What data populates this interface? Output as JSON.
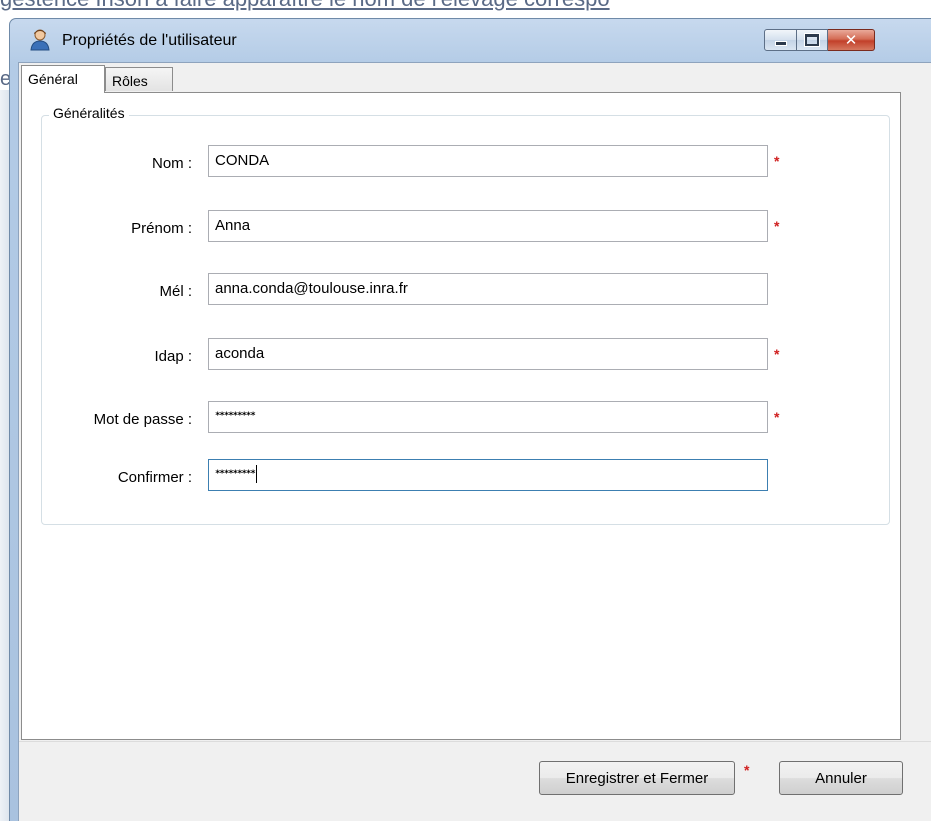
{
  "background": {
    "top_text": "gestence Inson à faire apparaître le nom de l'élevage correspo",
    "left_fragment": "e,"
  },
  "window": {
    "title": "Propriétés de l'utilisateur",
    "title_icon": "user-icon",
    "controls": {
      "minimize": "minimize-icon",
      "maximize": "maximize-icon",
      "close": "close-icon"
    }
  },
  "tabs": [
    {
      "label": "Général",
      "active": true
    },
    {
      "label": "Rôles",
      "active": false
    }
  ],
  "group": {
    "title": "Généralités",
    "fields": [
      {
        "label": "Nom :",
        "value": "CONDA",
        "required": true
      },
      {
        "label": "Prénom :",
        "value": "Anna",
        "required": true
      },
      {
        "label": "Mél :",
        "value": "anna.conda@toulouse.inra.fr",
        "required": false
      },
      {
        "label": "Idap :",
        "value": "aconda",
        "required": true
      },
      {
        "label": "Mot de passe :",
        "value": "*********",
        "required": true
      },
      {
        "label": "Confirmer :",
        "value": "*********",
        "required": false
      }
    ],
    "required_marker": "*"
  },
  "buttons": {
    "save": "Enregistrer et Fermer",
    "cancel": "Annuler"
  },
  "colors": {
    "required": "#d02020",
    "title_bar": "#b3cbe6",
    "close_button": "#c2402a"
  }
}
